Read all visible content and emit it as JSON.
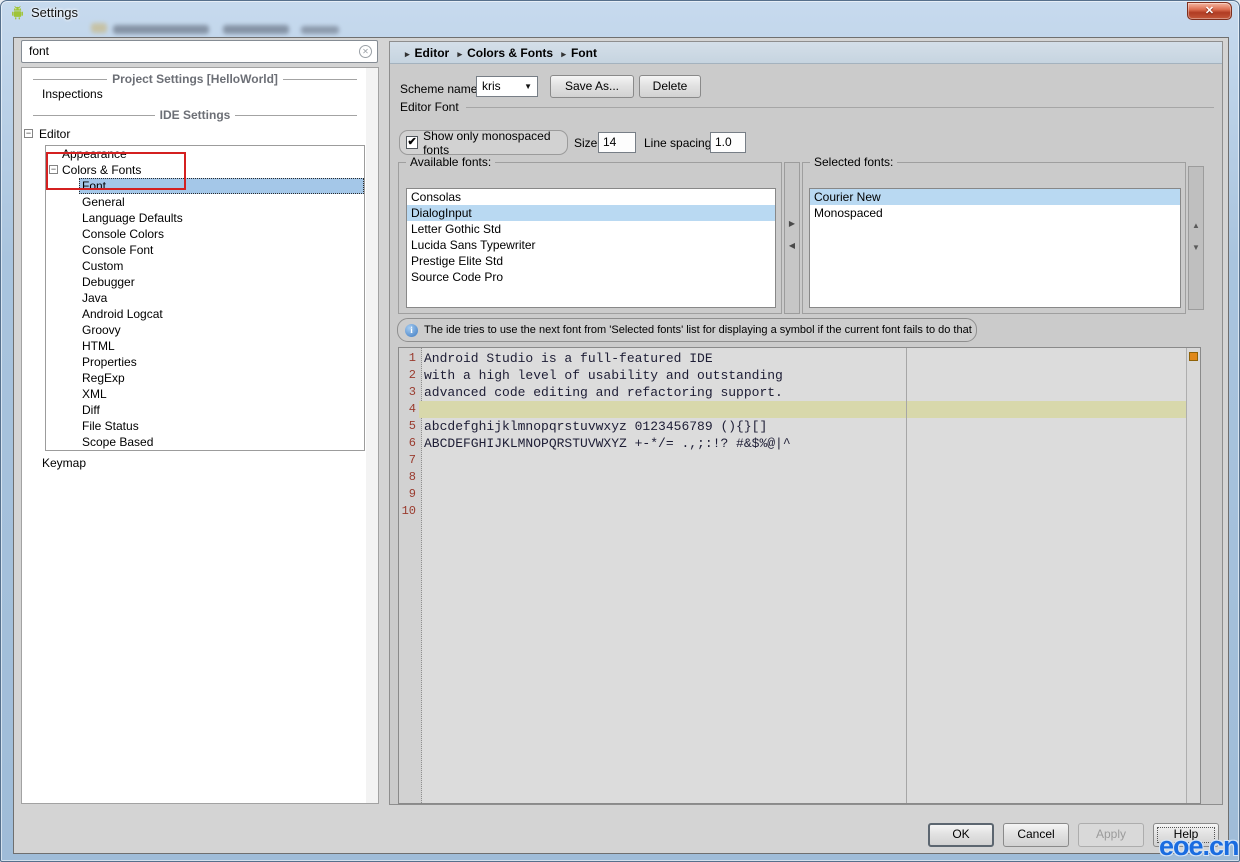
{
  "titlebar": {
    "title": "Settings"
  },
  "icons": {
    "close": "✕",
    "search_clear": "✕",
    "dropdown_arrow": "▼",
    "checkbox_check": "✔",
    "collapse": "−",
    "move_right": "▶",
    "move_left": "◀",
    "move_up": "▲",
    "move_down": "▼",
    "info": "i",
    "breadcrumb_separator": "▸"
  },
  "search": {
    "value": "font"
  },
  "sidebar": {
    "group1_title": "Project Settings [HelloWorld]",
    "group1_items": [
      {
        "label": "Inspections"
      }
    ],
    "group2_title": "IDE Settings",
    "root_label": "Editor",
    "tree": [
      {
        "label": "Appearance",
        "indent": 1
      },
      {
        "label": "Colors & Fonts",
        "indent": 1,
        "expander": true
      },
      {
        "label": "Font",
        "indent": 2,
        "selected": true
      },
      {
        "label": "General",
        "indent": 2
      },
      {
        "label": "Language Defaults",
        "indent": 2
      },
      {
        "label": "Console Colors",
        "indent": 2
      },
      {
        "label": "Console Font",
        "indent": 2
      },
      {
        "label": "Custom",
        "indent": 2
      },
      {
        "label": "Debugger",
        "indent": 2
      },
      {
        "label": "Java",
        "indent": 2
      },
      {
        "label": "Android Logcat",
        "indent": 2
      },
      {
        "label": "Groovy",
        "indent": 2
      },
      {
        "label": "HTML",
        "indent": 2
      },
      {
        "label": "Properties",
        "indent": 2
      },
      {
        "label": "RegExp",
        "indent": 2
      },
      {
        "label": "XML",
        "indent": 2
      },
      {
        "label": "Diff",
        "indent": 2
      },
      {
        "label": "File Status",
        "indent": 2
      },
      {
        "label": "Scope Based",
        "indent": 2
      }
    ],
    "keymap_label": "Keymap"
  },
  "main": {
    "breadcrumb": [
      "Editor",
      "Colors & Fonts",
      "Font"
    ],
    "scheme": {
      "label": "Scheme name:",
      "value": "kris",
      "save_as_label": "Save As...",
      "delete_label": "Delete"
    },
    "editor_font": {
      "title": "Editor Font",
      "monospaced_label": "Show only monospaced fonts",
      "monospaced_checked": true,
      "size_label": "Size:",
      "size_value": "14",
      "line_spacing_label": "Line spacing:",
      "line_spacing_value": "1.0"
    },
    "available_fonts": {
      "title": "Available fonts:",
      "items": [
        {
          "label": "Consolas"
        },
        {
          "label": "DialogInput",
          "selected": true
        },
        {
          "label": "Letter Gothic Std"
        },
        {
          "label": "Lucida Sans Typewriter"
        },
        {
          "label": "Prestige Elite Std"
        },
        {
          "label": "Source Code Pro"
        }
      ]
    },
    "selected_fonts": {
      "title": "Selected fonts:",
      "items": [
        {
          "label": "Courier New",
          "selected": true
        },
        {
          "label": "Monospaced"
        }
      ]
    },
    "info_text": "The ide tries to use the next font from 'Selected fonts' list for displaying a symbol if the current font fails to do that",
    "preview": {
      "lines": [
        {
          "num": "1",
          "text": "Android Studio is a full-featured IDE"
        },
        {
          "num": "2",
          "text": "with a high level of usability and outstanding"
        },
        {
          "num": "3",
          "text": "advanced code editing and refactoring support."
        },
        {
          "num": "4",
          "text": "",
          "current": true
        },
        {
          "num": "5",
          "text": "abcdefghijklmnopqrstuvwxyz 0123456789 (){}[]"
        },
        {
          "num": "6",
          "text": "ABCDEFGHIJKLMNOPQRSTUVWXYZ +-*/= .,;:!? #&$%@|^"
        },
        {
          "num": "7",
          "text": ""
        },
        {
          "num": "8",
          "text": ""
        },
        {
          "num": "9",
          "text": ""
        },
        {
          "num": "10",
          "text": ""
        }
      ]
    }
  },
  "footer": {
    "ok_label": "OK",
    "cancel_label": "Cancel",
    "apply_label": "Apply",
    "help_label": "Help"
  },
  "watermark": "eoe.cn",
  "colors": {
    "list_selection": "#b9d9f2",
    "tree_selection": "#a4c7e8",
    "annotation_red": "#d42020",
    "current_line_highlight": "#d8d8ab",
    "gutter_number": "#9a3b2e",
    "error_stripe_marker": "#e0891c",
    "watermark_blue": "#1a6ce0",
    "titlebar_blue": "#a9c4de",
    "breadcrumb_bar": "#ccd8e3"
  }
}
